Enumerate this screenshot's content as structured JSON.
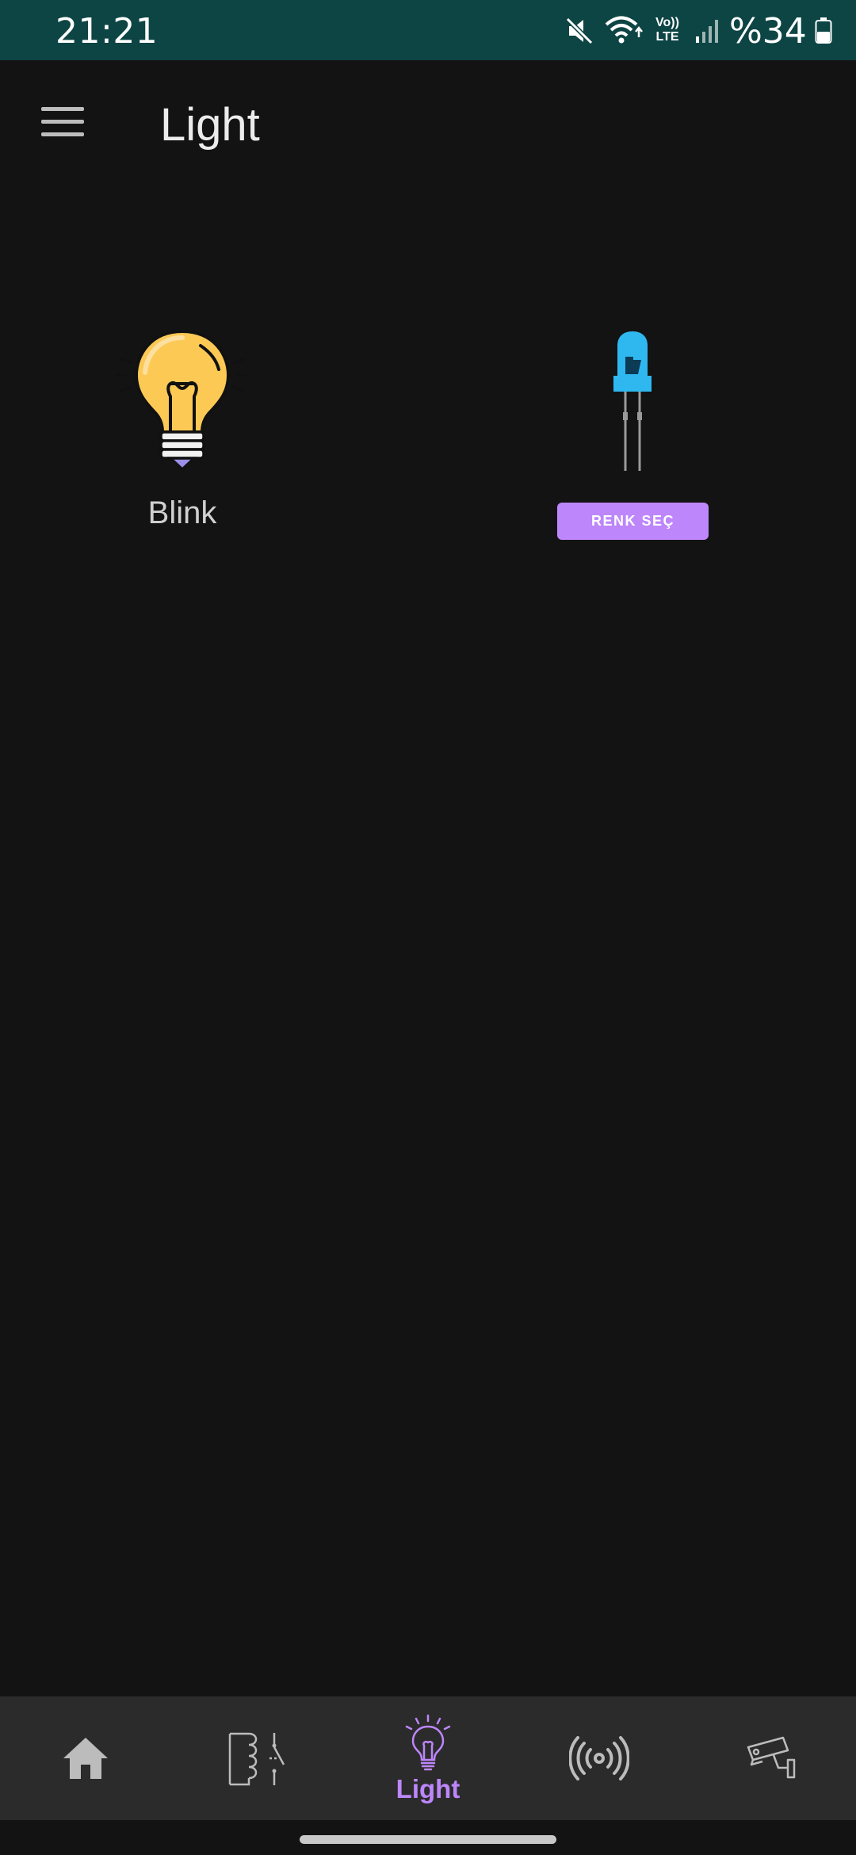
{
  "status_bar": {
    "time": "21:21",
    "battery_text": "%34",
    "icons": [
      "mute-icon",
      "wifi-icon",
      "volte-lte-icon",
      "signal-icon",
      "battery-icon"
    ],
    "volte_top": "Vo))",
    "volte_bottom": "LTE"
  },
  "app_bar": {
    "title": "Light",
    "menu_icon": "hamburger-menu-icon"
  },
  "content": {
    "blink": {
      "icon": "light-bulb-icon",
      "label": "Blink"
    },
    "led": {
      "icon": "led-diode-icon",
      "led_color": "#2fb8f0",
      "button_label": "RENK SEÇ"
    }
  },
  "bottom_nav": {
    "items": [
      {
        "icon": "home-icon",
        "active": false
      },
      {
        "icon": "relay-icon",
        "active": false
      },
      {
        "icon": "light-bulb-icon",
        "label": "Light",
        "active": true
      },
      {
        "icon": "signal-broadcast-icon",
        "active": false
      },
      {
        "icon": "security-camera-icon",
        "active": false
      }
    ],
    "active_color": "#bd86fb"
  },
  "colors": {
    "status_bar": "#0d4444",
    "background": "#131314",
    "nav_background": "#2b2b2b",
    "accent": "#bd86fb"
  }
}
